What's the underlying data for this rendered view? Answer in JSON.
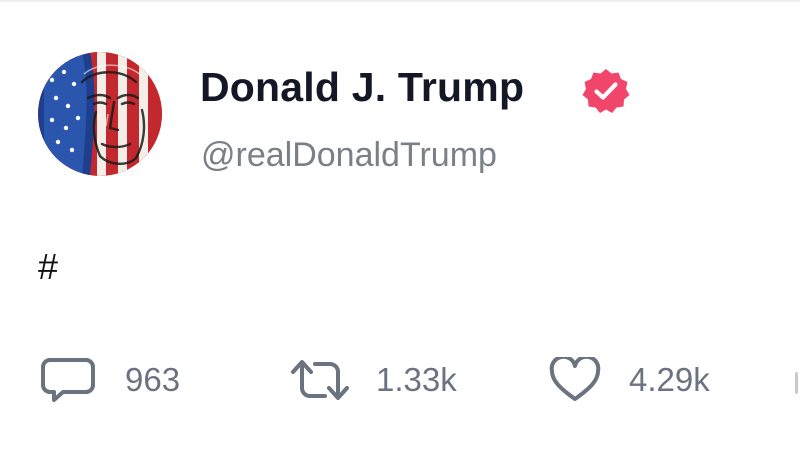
{
  "post": {
    "author": {
      "display_name": "Donald J. Trump",
      "handle": "@realDonaldTrump",
      "verified": true,
      "avatar_icon": "flag-portrait-avatar"
    },
    "body": "#",
    "actions": {
      "replies": {
        "icon": "comment-icon",
        "count": "963"
      },
      "retruths": {
        "icon": "retruth-icon",
        "count": "1.33k"
      },
      "likes": {
        "icon": "heart-icon",
        "count": "4.29k"
      }
    }
  },
  "colors": {
    "verified_badge": "#f1456c",
    "display_name": "#141826",
    "handle": "#7a7f88",
    "action_icon": "#6b7280"
  }
}
